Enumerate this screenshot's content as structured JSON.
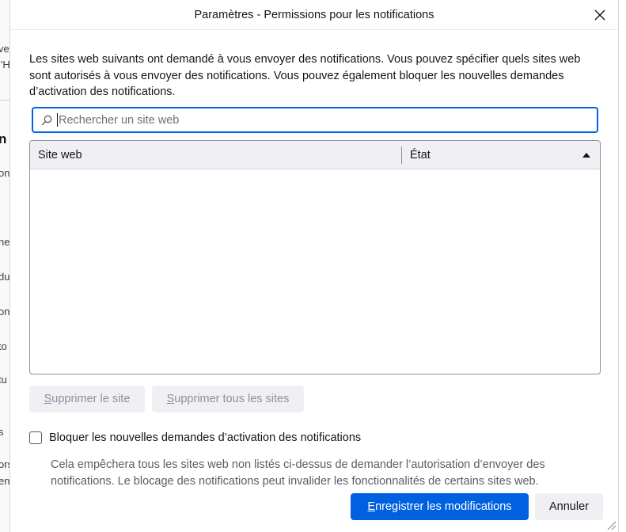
{
  "background_page": {
    "fragments": [
      "ve",
      "l'H",
      "n",
      "on",
      "ne",
      "du",
      "on",
      "to",
      "tu",
      "s",
      "ors",
      "en"
    ]
  },
  "dialog": {
    "title": "Paramètres - Permissions pour les notifications",
    "close_icon": "close-icon",
    "description": "Les sites web suivants ont demandé à vous envoyer des notifications. Vous pouvez spécifier quels sites web sont autorisés à vous envoyer des notifications. Vous pouvez également bloquer les nouvelles demandes d’activation des notifications.",
    "search": {
      "placeholder": "Rechercher un site web",
      "value": "",
      "icon": "search-icon"
    },
    "table": {
      "columns": [
        "Site web",
        "État"
      ],
      "sort_icon": "sort-ascending-icon",
      "rows": []
    },
    "buttons": {
      "remove_site": {
        "prefix": "",
        "access_key": "S",
        "rest": "upprimer le site"
      },
      "remove_all": {
        "prefix": "",
        "access_key": "S",
        "rest": "upprimer tous les sites"
      },
      "save": {
        "prefix": "",
        "access_key": "E",
        "rest": "nregistrer les modifications"
      },
      "cancel": "Annuler"
    },
    "block_checkbox": {
      "label": "Bloquer les nouvelles demandes d’activation des notifications",
      "checked": false,
      "note": "Cela empêchera tous les sites web non listés ci-dessus de demander l’autorisation d’envoyer des notifications. Le blocage des notifications peut invalider les fonctionnalités de certains sites web."
    },
    "colors": {
      "accent": "#0061e0",
      "disabled_button": "#f0f0f4",
      "disabled_text": "#8f8f9d"
    }
  }
}
